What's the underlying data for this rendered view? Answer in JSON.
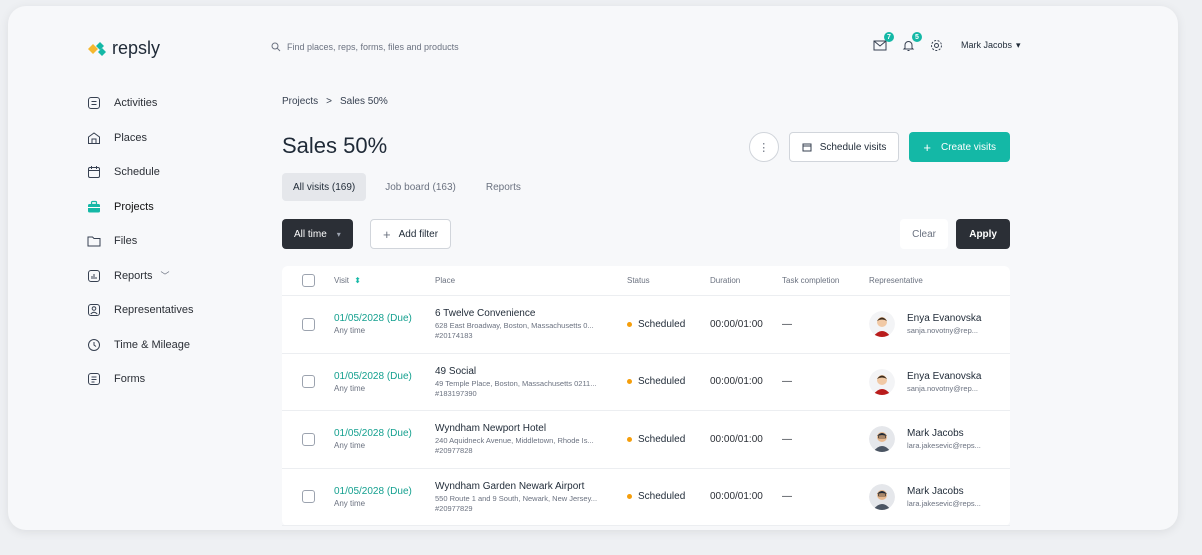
{
  "app": {
    "logo_text": "repsly"
  },
  "search": {
    "placeholder": "Find places, reps, forms, files and products"
  },
  "top_bar": {
    "messages_count": "7",
    "notifications_count": "5",
    "user_name": "Mark Jacobs"
  },
  "sidebar": {
    "items": [
      {
        "label": "Activities",
        "icon": "activities-icon"
      },
      {
        "label": "Places",
        "icon": "places-icon"
      },
      {
        "label": "Schedule",
        "icon": "calendar-icon"
      },
      {
        "label": "Projects",
        "icon": "briefcase-icon",
        "active": true
      },
      {
        "label": "Files",
        "icon": "folder-icon"
      },
      {
        "label": "Reports",
        "icon": "chart-icon",
        "chevron": true
      },
      {
        "label": "Representatives",
        "icon": "user-icon"
      },
      {
        "label": "Time & Mileage",
        "icon": "clock-icon"
      },
      {
        "label": "Forms",
        "icon": "form-icon"
      }
    ]
  },
  "breadcrumb": {
    "parent": "Projects",
    "separator": ">",
    "current": "Sales 50%"
  },
  "page": {
    "title": "Sales 50%",
    "more_label": "⋮",
    "schedule_label": "Schedule visits",
    "create_label": "Create visits"
  },
  "tabs": [
    {
      "label": "All visits (169)",
      "active": true
    },
    {
      "label": "Job board (163)",
      "active": false
    },
    {
      "label": "Reports",
      "active": false
    }
  ],
  "filters": {
    "time_label": "All time",
    "add_label": "Add filter",
    "clear_label": "Clear",
    "apply_label": "Apply"
  },
  "table": {
    "headers": {
      "visit": "Visit",
      "place": "Place",
      "status": "Status",
      "duration": "Duration",
      "task": "Task completion",
      "rep": "Representative"
    },
    "rows": [
      {
        "date": "01/05/2028 (Due)",
        "time": "Any time",
        "place": "6 Twelve Convenience",
        "address": "628 East Broadway, Boston, Massachusetts 0...",
        "place_id": "#20174183",
        "status": "Scheduled",
        "duration": "00:00/01:00",
        "task": "—",
        "rep_name": "Enya Evanovska",
        "rep_email": "sanja.novotny@rep..."
      },
      {
        "date": "01/05/2028 (Due)",
        "time": "Any time",
        "place": "49 Social",
        "address": "49 Temple Place, Boston, Massachusetts 0211...",
        "place_id": "#183197390",
        "status": "Scheduled",
        "duration": "00:00/01:00",
        "task": "—",
        "rep_name": "Enya Evanovska",
        "rep_email": "sanja.novotny@rep..."
      },
      {
        "date": "01/05/2028 (Due)",
        "time": "Any time",
        "place": "Wyndham Newport Hotel",
        "address": "240 Aquidneck Avenue, Middletown, Rhode Is...",
        "place_id": "#20977828",
        "status": "Scheduled",
        "duration": "00:00/01:00",
        "task": "—",
        "rep_name": "Mark Jacobs",
        "rep_email": "lara.jakesevic@reps..."
      },
      {
        "date": "01/05/2028 (Due)",
        "time": "Any time",
        "place": "Wyndham Garden Newark Airport",
        "address": "550 Route 1 and 9 South, Newark, New Jersey...",
        "place_id": "#20977829",
        "status": "Scheduled",
        "duration": "00:00/01:00",
        "task": "—",
        "rep_name": "Mark Jacobs",
        "rep_email": "lara.jakesevic@reps..."
      }
    ]
  },
  "colors": {
    "accent": "#14b8a6",
    "dark": "#2b2f36",
    "status_scheduled": "#f59e0b"
  }
}
